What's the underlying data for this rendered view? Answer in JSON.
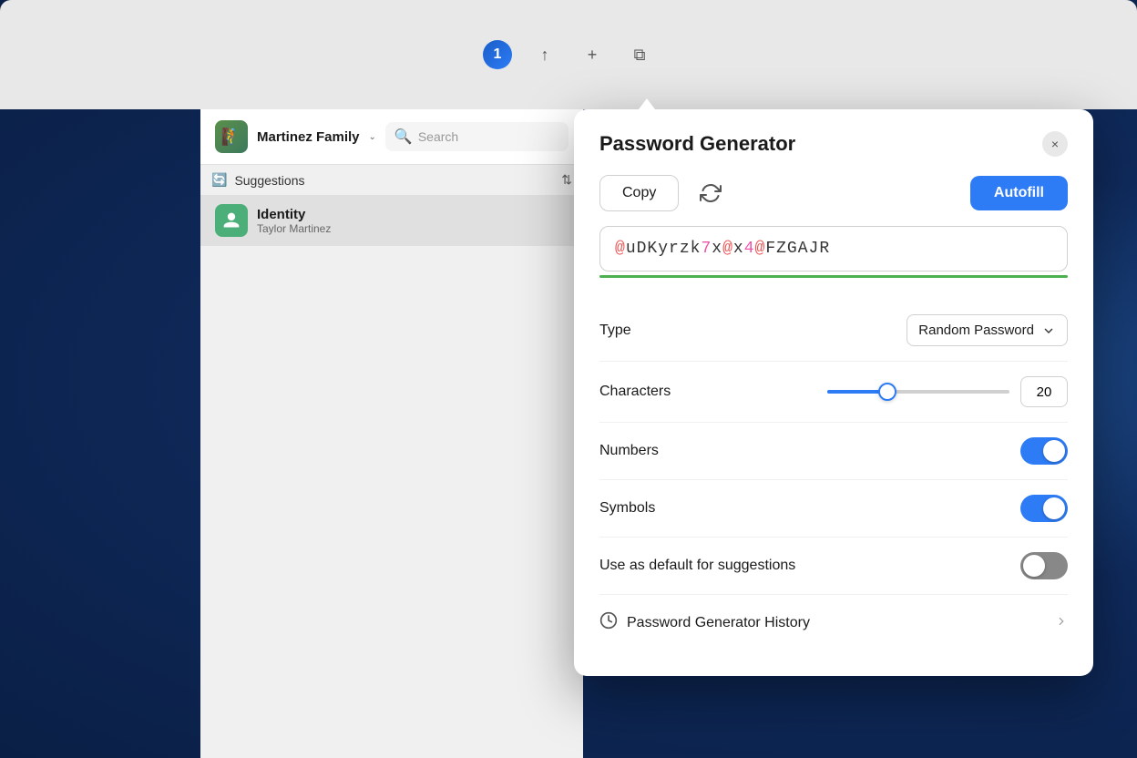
{
  "background": "#1a3a6b",
  "browser": {
    "icons": [
      "1password",
      "share",
      "add-tab",
      "tab-overview"
    ]
  },
  "sidebar": {
    "vault_name": "Martinez Family",
    "vault_chevron": "⌄",
    "search_placeholder": "Search",
    "section_label": "Suggestions",
    "section_icon": "🔄",
    "items": [
      {
        "type": "Identity",
        "subtitle": "Taylor Martinez",
        "icon_color": "#4caf7a"
      }
    ]
  },
  "modal": {
    "title": "Password Generator",
    "close_label": "×",
    "copy_label": "Copy",
    "autofill_label": "Autofill",
    "password_value": "@uDKyrzk7x@x4@FZGAJR",
    "type_label": "Type",
    "type_value": "Random Password",
    "characters_label": "Characters",
    "characters_value": "20",
    "slider_percent": 33,
    "numbers_label": "Numbers",
    "numbers_on": true,
    "symbols_label": "Symbols",
    "symbols_on": true,
    "default_suggestions_label": "Use as default for suggestions",
    "default_suggestions_on": false,
    "history_label": "Password Generator History"
  }
}
